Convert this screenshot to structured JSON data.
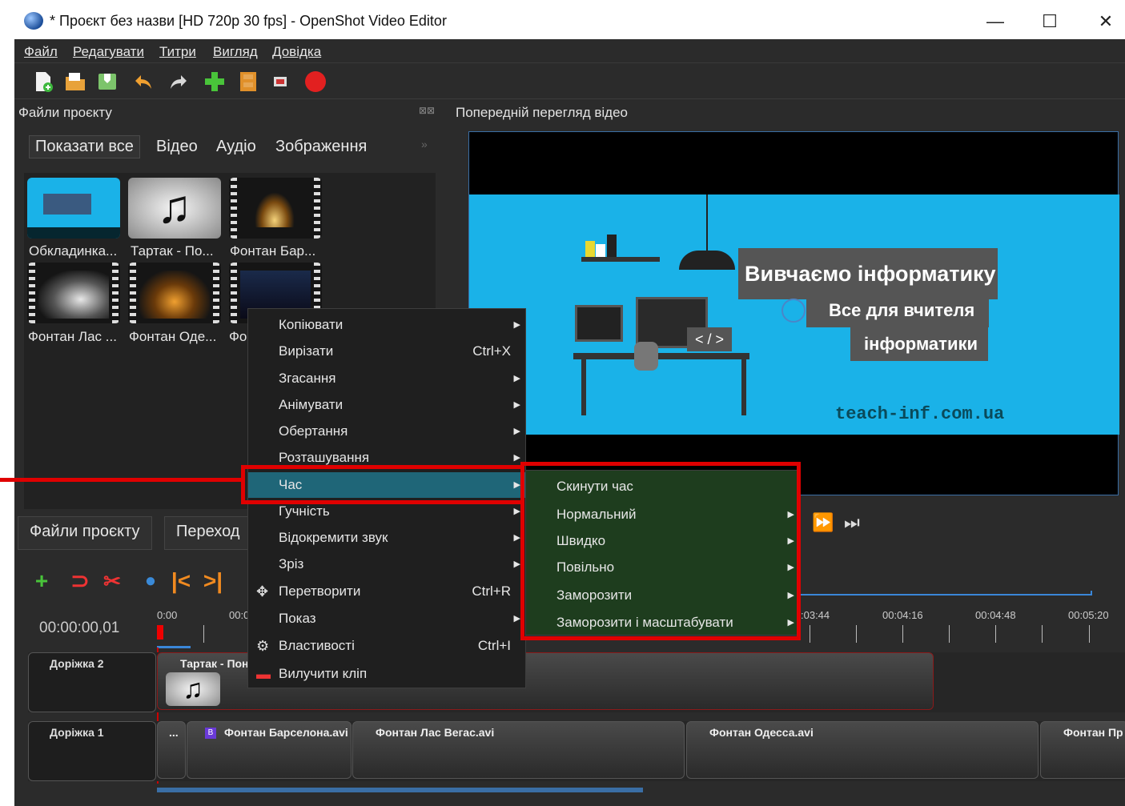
{
  "window": {
    "title": "* Проєкт без назви [HD 720p 30 fps] - OpenShot Video Editor",
    "min": "—",
    "max": "☐",
    "close": "✕"
  },
  "menubar": [
    "Файл",
    "Редагувати",
    "Титри",
    "Вигляд",
    "Довідка"
  ],
  "docks": {
    "project_files": "Файли проєкту",
    "video_preview": "Попередній перегляд відео"
  },
  "filter_tabs": [
    "Показати все",
    "Відео",
    "Аудіо",
    "Зображення"
  ],
  "files": [
    {
      "name": "Обкладинка...",
      "icon": "image-thumbnail"
    },
    {
      "name": "Тартак - По...",
      "icon": "music-note-icon"
    },
    {
      "name": "Фонтан Бар...",
      "icon": "video-thumbnail"
    },
    {
      "name": "Фонтан Лас ...",
      "icon": "video-thumbnail"
    },
    {
      "name": "Фонтан Оде...",
      "icon": "video-thumbnail"
    },
    {
      "name": "Фо",
      "icon": "video-thumbnail"
    }
  ],
  "preview_card": {
    "title": "Вивчаємо інформатику",
    "line1": "Все для вчителя",
    "line2": "інформатики",
    "site": "teach-inf.com.ua"
  },
  "bottom_tabs": [
    "Файли проєкту",
    "Переход"
  ],
  "timecode": "00:00:00,01",
  "ruler_labels": [
    "0:00",
    "00:0",
    ":03:44",
    "00:04:16",
    "00:04:48",
    "00:05:20"
  ],
  "tracks": [
    {
      "name": "Доріжка 2",
      "clips": [
        "Тартак - Пон"
      ]
    },
    {
      "name": "Доріжка 1",
      "clips": [
        "...",
        "Фонтан Барселона.avi",
        "Фонтан Лас Вегас.avi",
        "Фонтан Одесса.avi",
        "Фонтан Пр"
      ]
    }
  ],
  "clip_badge": "B",
  "context_menu": [
    {
      "label": "Копіювати",
      "shortcut": "",
      "submenu": true
    },
    {
      "label": "Вирізати",
      "shortcut": "Ctrl+X",
      "submenu": false
    },
    {
      "label": "Згасання",
      "shortcut": "",
      "submenu": true
    },
    {
      "label": "Анімувати",
      "shortcut": "",
      "submenu": true
    },
    {
      "label": "Обертання",
      "shortcut": "",
      "submenu": true
    },
    {
      "label": "Розташування",
      "shortcut": "",
      "submenu": true
    },
    {
      "label": "Час",
      "shortcut": "",
      "submenu": true
    },
    {
      "label": "Гучність",
      "shortcut": "",
      "submenu": true
    },
    {
      "label": "Відокремити звук",
      "shortcut": "",
      "submenu": true
    },
    {
      "label": "Зріз",
      "shortcut": "",
      "submenu": true
    },
    {
      "label": "Перетворити",
      "shortcut": "Ctrl+R",
      "submenu": false
    },
    {
      "label": "Показ",
      "shortcut": "",
      "submenu": true
    },
    {
      "label": "Властивості",
      "shortcut": "Ctrl+I",
      "submenu": false
    },
    {
      "label": "Вилучити кліп",
      "shortcut": "",
      "submenu": false
    }
  ],
  "time_submenu": [
    {
      "label": "Скинути час",
      "submenu": false
    },
    {
      "label": "Нормальний",
      "submenu": true
    },
    {
      "label": "Швидко",
      "submenu": true
    },
    {
      "label": "Повільно",
      "submenu": true
    },
    {
      "label": "Заморозити",
      "submenu": true
    },
    {
      "label": "Заморозити і масштабувати",
      "submenu": true
    }
  ],
  "highlight_color": "#e00000",
  "menu_highlight_color": "#1f6678"
}
